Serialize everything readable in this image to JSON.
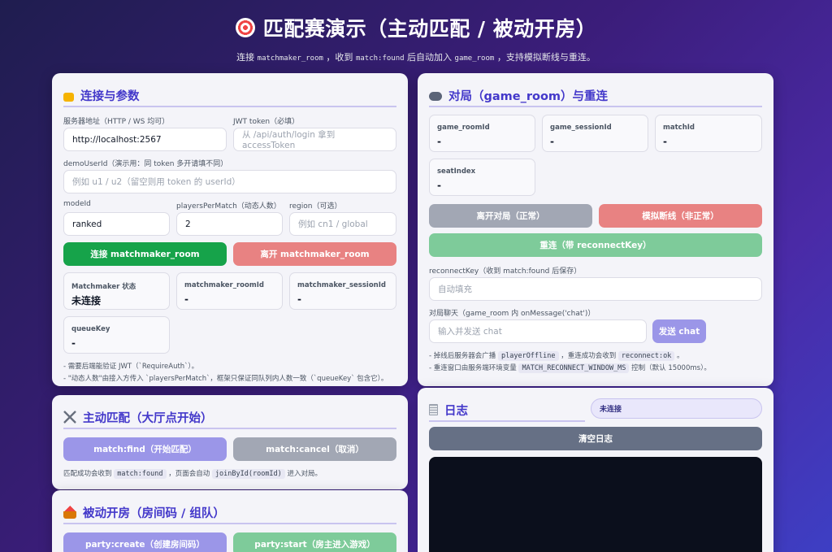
{
  "header": {
    "title": "匹配赛演示（主动匹配 / 被动开房）",
    "subtitle": {
      "t1": "连接 ",
      "c1": "matchmaker_room",
      "t2": " ，收到 ",
      "c2": "match:found",
      "t3": " 后自动加入 ",
      "c3": "game_room",
      "t4": " ，支持模拟断线与重连。"
    }
  },
  "connection": {
    "title": "连接与参数",
    "server_label": "服务器地址（HTTP / WS 均可）",
    "server_value": "http://localhost:2567",
    "jwt_label": "JWT token（必填）",
    "jwt_placeholder": "从 /api/auth/login 拿到 accessToken",
    "demo_label": "demoUserId（演示用：同 token 多开请填不同）",
    "demo_placeholder": "例如 u1 / u2（留空则用 token 的 userId）",
    "mode_label": "modeId",
    "mode_value": "ranked",
    "players_label": "playersPerMatch（动态人数）",
    "players_value": "2",
    "region_label": "region（可选）",
    "region_placeholder": "例如 cn1 / global",
    "connect_btn": "连接 matchmaker_room",
    "leave_btn": "离开 matchmaker_room",
    "status": [
      {
        "k": "Matchmaker 状态",
        "v": "未连接"
      },
      {
        "k": "matchmaker_roomId",
        "v": "-"
      },
      {
        "k": "matchmaker_sessionId",
        "v": "-"
      },
      {
        "k": "queueKey",
        "v": "-"
      }
    ],
    "note1": "- 需要后端能验证 JWT（`RequireAuth`）。",
    "note2": "- \"动态人数\"由接入方传入 `playersPerMatch`，框架只保证同队列内人数一致（`queueKey` 包含它）。"
  },
  "active": {
    "title": "主动匹配（大厅点开始）",
    "find_btn": "match:find（开始匹配）",
    "cancel_btn": "match:cancel（取消）",
    "note": {
      "t1": "匹配成功会收到 ",
      "c1": "match:found",
      "t2": " ，页面会自动 ",
      "c2": "joinById(roomId)",
      "t3": " 进入对局。"
    }
  },
  "passive": {
    "title": "被动开房（房间码 / 组队）",
    "create_btn": "party:create（创建房间码）",
    "start_btn": "party:start（房主进入游戏）"
  },
  "game": {
    "title": "对局（game_room）与重连",
    "status": [
      {
        "k": "game_roomId",
        "v": "-"
      },
      {
        "k": "game_sessionId",
        "v": "-"
      },
      {
        "k": "matchId",
        "v": "-"
      },
      {
        "k": "seatIndex",
        "v": "-"
      }
    ],
    "leave_btn": "离开对局（正常）",
    "drop_btn": "模拟断线（非正常）",
    "reconnect_btn": "重连（带 reconnectKey）",
    "key_label": "reconnectKey（收到 match:found 后保存）",
    "key_placeholder": "自动填充",
    "chat_label": "对局聊天（game_room 内 onMessage('chat')）",
    "chat_placeholder": "输入并发送 chat",
    "chat_btn": "发送 chat",
    "note1": {
      "t1": "- 掉线后服务器会广播 ",
      "c1": "playerOffline",
      "t2": " ，重连成功会收到 ",
      "c2": "reconnect:ok",
      "t3": " 。"
    },
    "note2": {
      "t1": "- 重连窗口由服务端环境变量 ",
      "c1": "MATCH_RECONNECT_WINDOW_MS",
      "t2": " 控制（默认 15000ms）。"
    }
  },
  "log": {
    "title": "日志",
    "status": "未连接",
    "clear_btn": "清空日志"
  },
  "colors": {
    "green": "#16a34a",
    "red": "#e88282",
    "purple": "#9b96e8",
    "gray": "#a2a7b4",
    "green_light": "#7ecb9a",
    "slate": "#667085",
    "console": "#0b0f1c"
  }
}
